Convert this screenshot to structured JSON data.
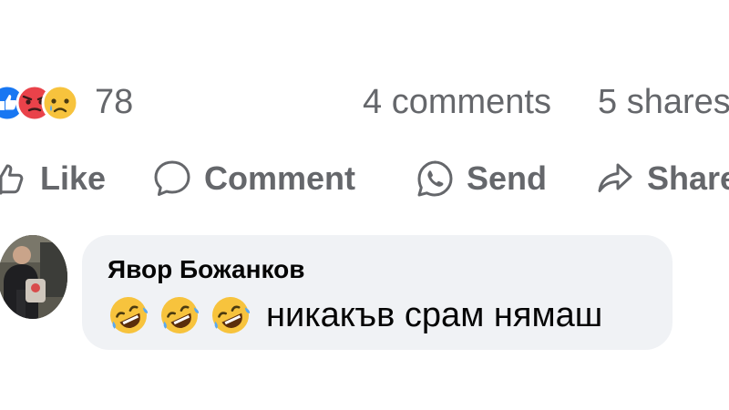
{
  "post": {
    "reactions": {
      "icons": [
        "like-icon",
        "angry-icon",
        "sad-icon"
      ],
      "count": "78"
    },
    "comments_count": "4 comments",
    "shares_count": "5 shares"
  },
  "actions": {
    "like_label": "Like",
    "comment_label": "Comment",
    "send_label": "Send",
    "share_label": "Share"
  },
  "comment": {
    "author": "Явор Божанков",
    "emojis": [
      "rolling-on-floor-laughing-icon",
      "rolling-on-floor-laughing-icon",
      "rolling-on-floor-laughing-icon"
    ],
    "text": "никакъв срам нямаш"
  },
  "colors": {
    "secondary_text": "#65676b",
    "primary_text": "#050505",
    "bubble_bg": "#f0f2f5",
    "like_blue": "#1877f2",
    "angry_red": "#e9424a",
    "emoji_yellow": "#f7c33d"
  }
}
